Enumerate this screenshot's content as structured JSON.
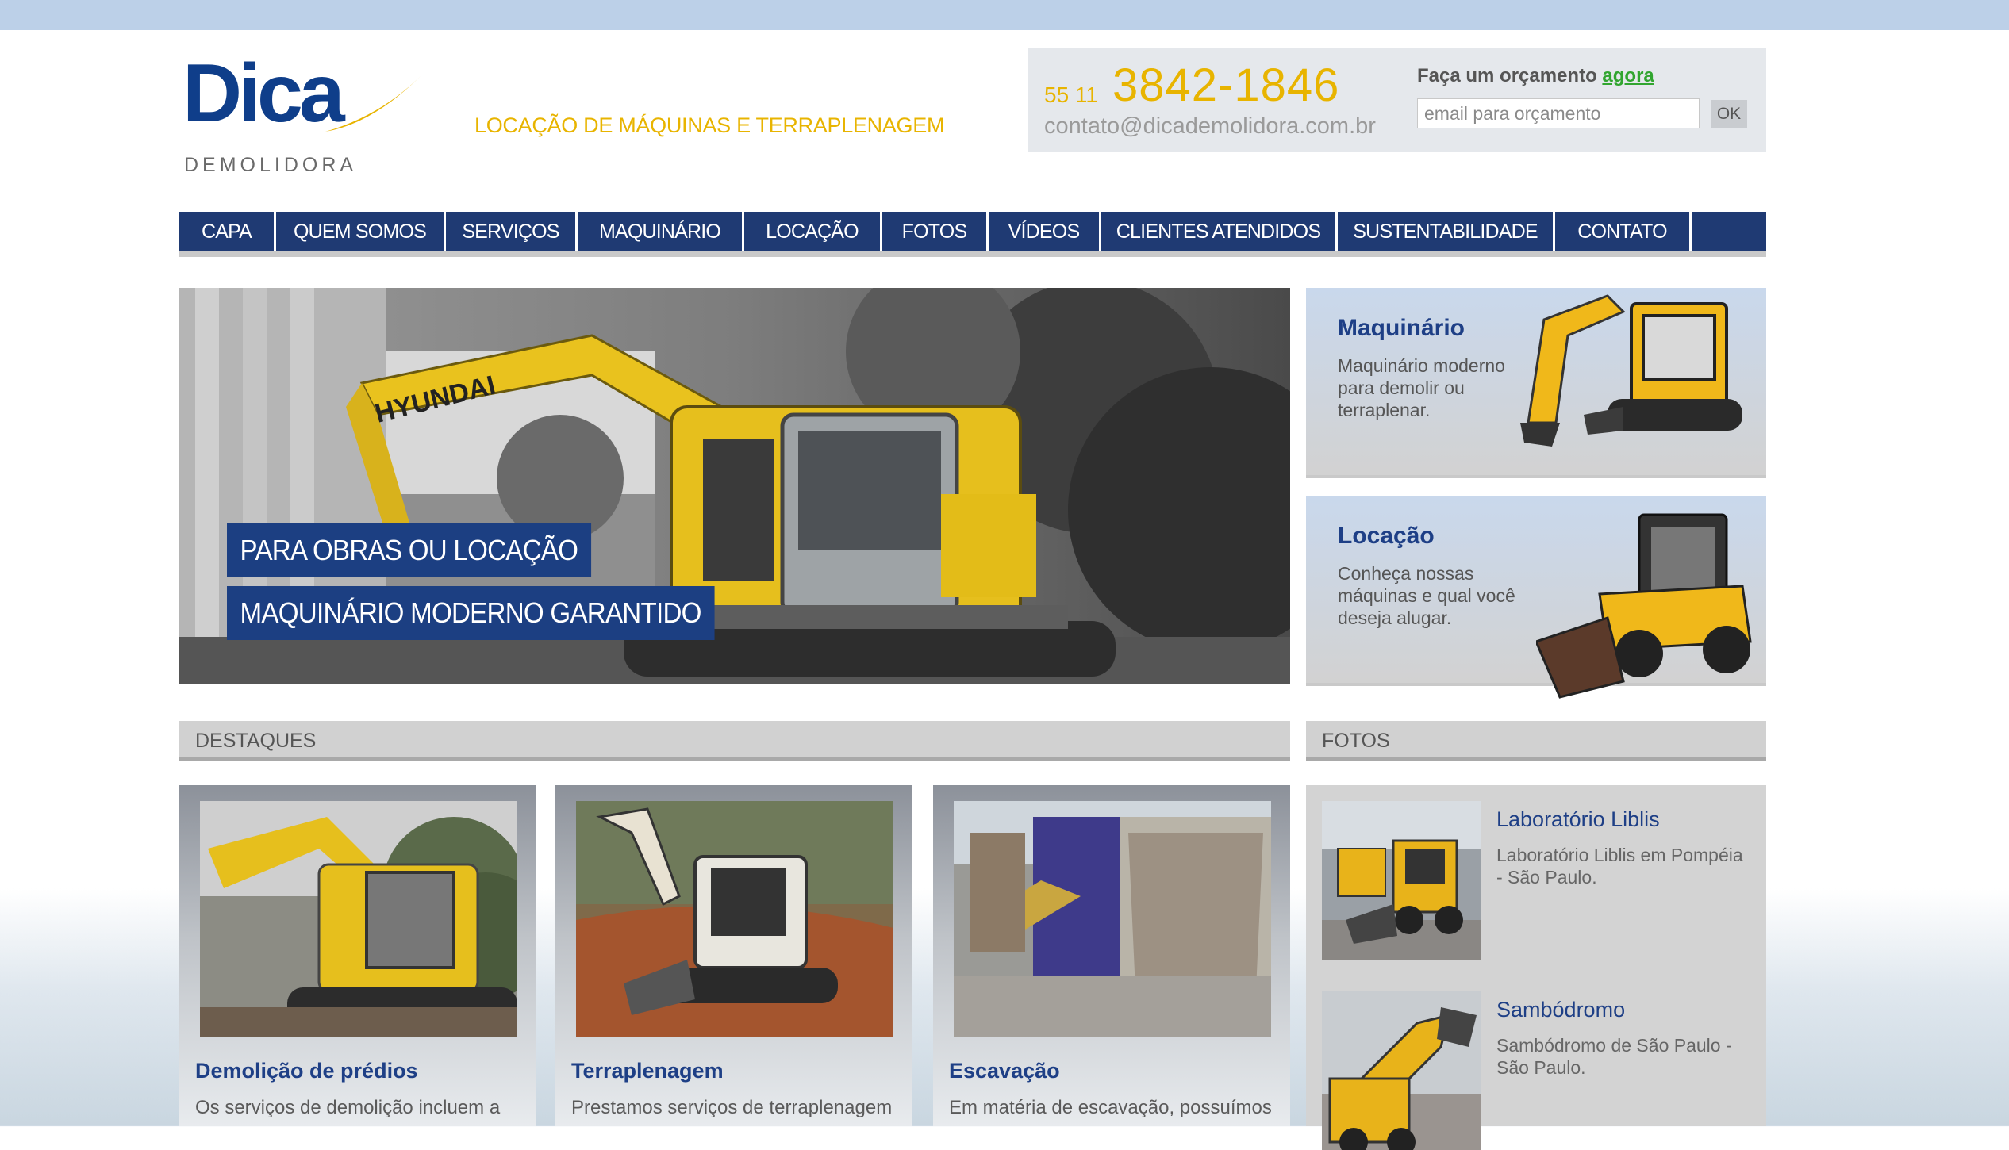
{
  "brand": {
    "name": "Dica",
    "subtitle": "DEMOLIDORA",
    "tagline": "LOCAÇÃO DE MÁQUINAS E TERRAPLENAGEM",
    "colors": {
      "navy": "#1f3a73",
      "accent_yellow": "#e8b400",
      "link_green": "#31a52f",
      "heading_blue": "#1e3f86"
    }
  },
  "contact": {
    "phone_prefix": "55 11",
    "phone": "3842-1846",
    "email": "contato@dicademolidora.com.br",
    "quote_label": "Faça um orçamento ",
    "quote_link": "agora",
    "quote_placeholder": "email para orçamento",
    "ok_label": "OK"
  },
  "nav": [
    {
      "label": "CAPA"
    },
    {
      "label": "QUEM SOMOS"
    },
    {
      "label": "SERVIÇOS"
    },
    {
      "label": "MAQUINÁRIO"
    },
    {
      "label": "LOCAÇÃO"
    },
    {
      "label": "FOTOS"
    },
    {
      "label": "VÍDEOS"
    },
    {
      "label": "CLIENTES ATENDIDOS"
    },
    {
      "label": "SUSTENTABILIDADE"
    },
    {
      "label": "CONTATO"
    }
  ],
  "hero": {
    "caption1": "PARA OBRAS OU LOCAÇÃO",
    "caption2": "MAQUINÁRIO MODERNO GARANTIDO",
    "machine_text": "HYUNDAI"
  },
  "promos": [
    {
      "title": "Maquinário",
      "text": "Maquinário moderno para demolir ou terraplenar."
    },
    {
      "title": "Locação",
      "text": "Conheça nossas máquinas e qual você deseja alugar."
    }
  ],
  "sections": {
    "highlights": "DESTAQUES",
    "photos": "FOTOS"
  },
  "highlights": [
    {
      "title": "Demolição de prédios",
      "text": "Os serviços de demolição incluem a"
    },
    {
      "title": "Terraplenagem",
      "text": "Prestamos serviços de terraplenagem"
    },
    {
      "title": "Escavação",
      "text": "Em matéria de escavação, possuímos"
    }
  ],
  "photos": [
    {
      "title": "Laboratório Liblis",
      "text": "Laboratório Liblis em Pompéia - São Paulo."
    },
    {
      "title": "Sambódromo",
      "text": "Sambódromo de São Paulo - São Paulo."
    }
  ]
}
